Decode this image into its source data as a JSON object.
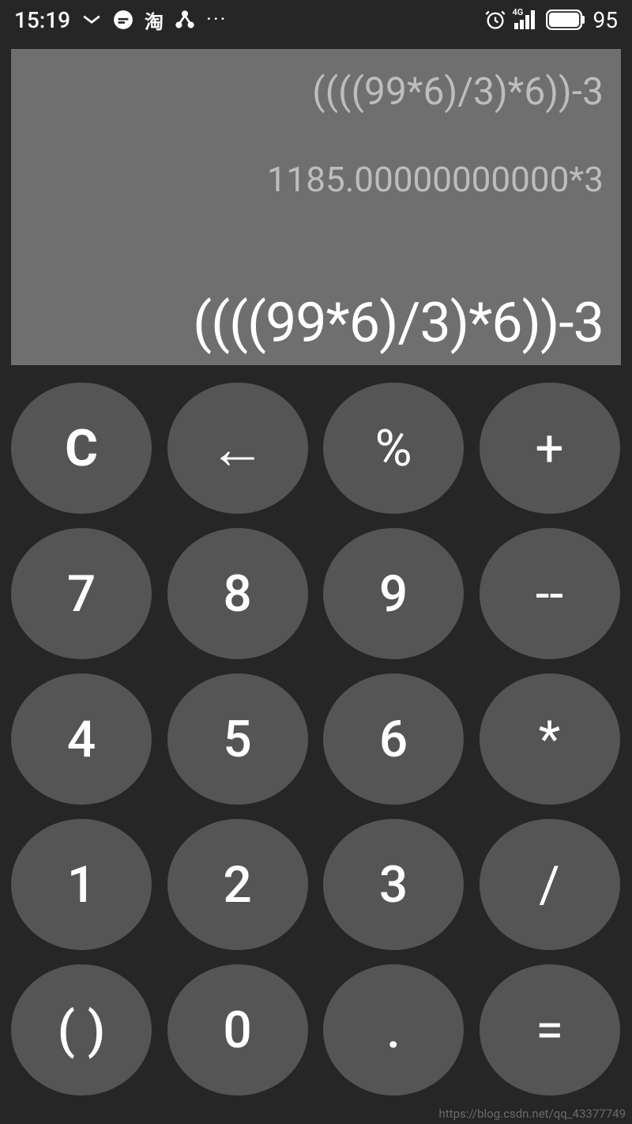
{
  "status": {
    "time": "15:19",
    "battery": "95",
    "icons": {
      "missed": "missed-call-icon",
      "chat": "chat-icon",
      "tao": "淘",
      "share": "share-icon",
      "dots": "···",
      "alarm": "alarm-icon",
      "signal_label": "4G",
      "signal": "signal-icon",
      "battery_icon": "battery-icon"
    }
  },
  "display": {
    "history1": "((((99*6)/3)*6))-3",
    "history2": "1185.00000000000*3",
    "current": "((((99*6)/3)*6))-3"
  },
  "keys": {
    "r0c0": "C",
    "r0c1": "←",
    "r0c2": "%",
    "r0c3": "+",
    "r1c0": "7",
    "r1c1": "8",
    "r1c2": "9",
    "r1c3": "--",
    "r2c0": "4",
    "r2c1": "5",
    "r2c2": "6",
    "r2c3": "*",
    "r3c0": "1",
    "r3c1": "2",
    "r3c2": "3",
    "r3c3": "/",
    "r4c0": "( )",
    "r4c1": "0",
    "r4c2": ".",
    "r4c3": "="
  },
  "watermark": "https://blog.csdn.net/qq_43377749"
}
